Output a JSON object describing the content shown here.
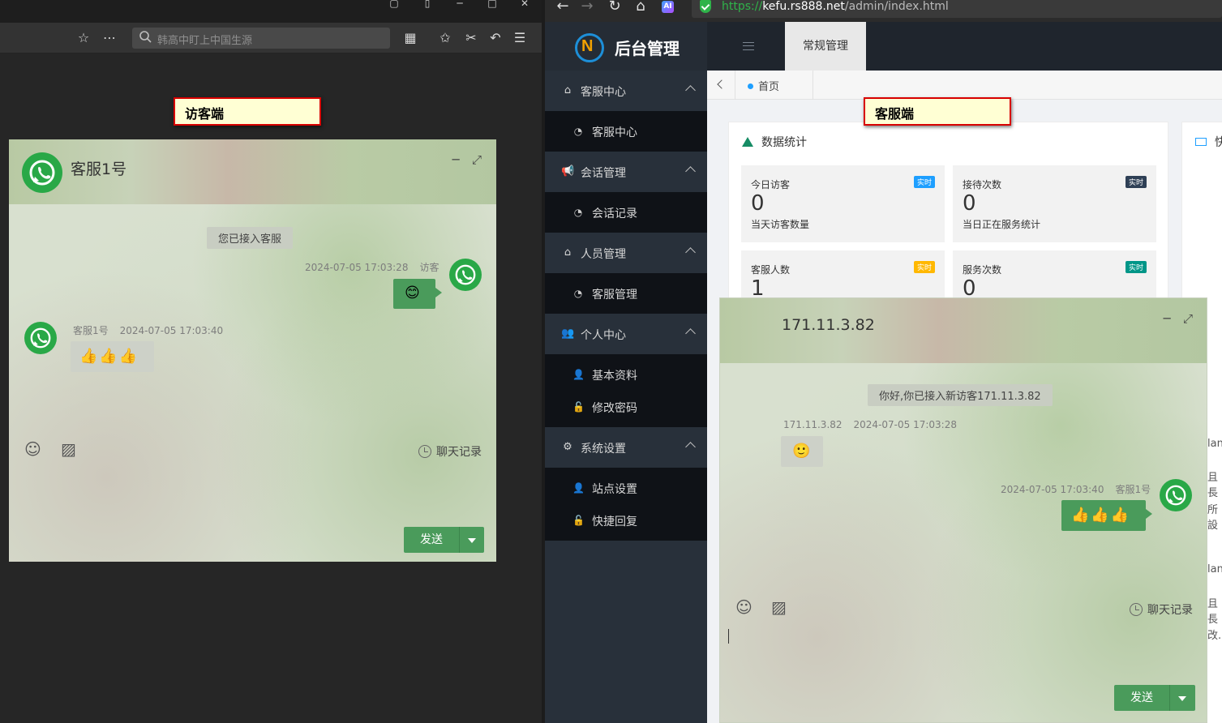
{
  "left_window": {
    "search_placeholder": "韩高中盯上中国生源",
    "annotation": "访客端",
    "chat": {
      "title": "客服1号",
      "system_message": "您已接入客服",
      "messages": [
        {
          "side": "right",
          "sender": "访客",
          "time": "2024-07-05 17:03:28",
          "content": "😊"
        },
        {
          "side": "left",
          "sender": "客服1号",
          "time": "2024-07-05 17:03:40",
          "content": "👍👍👍"
        }
      ],
      "history_label": "聊天记录",
      "send_label": "发送"
    }
  },
  "right_window": {
    "url": {
      "scheme": "https://",
      "host": "kefu.rs888.net",
      "path": "/admin/index.html"
    },
    "ai_label": "AI",
    "logo_text": "后台管理",
    "top_tab": "常规管理",
    "home_tab": "首页",
    "annotation": "客服端",
    "sidebar": [
      {
        "label": "客服中心",
        "icon": "home-icon",
        "items": [
          {
            "label": "客服中心",
            "icon": "dashboard-icon"
          }
        ]
      },
      {
        "label": "会话管理",
        "icon": "megaphone-icon",
        "items": [
          {
            "label": "会话记录",
            "icon": "dashboard-icon"
          }
        ]
      },
      {
        "label": "人员管理",
        "icon": "home-icon",
        "items": [
          {
            "label": "客服管理",
            "icon": "dashboard-icon"
          }
        ]
      },
      {
        "label": "个人中心",
        "icon": "users-icon",
        "items": [
          {
            "label": "基本资料",
            "icon": "user-icon"
          },
          {
            "label": "修改密码",
            "icon": "lock-icon"
          }
        ]
      },
      {
        "label": "系统设置",
        "icon": "gears-icon",
        "items": [
          {
            "label": "站点设置",
            "icon": "user-icon"
          },
          {
            "label": "快捷回复",
            "icon": "lock-icon"
          }
        ]
      }
    ],
    "stats": {
      "title": "数据统计",
      "cards": [
        {
          "label": "今日访客",
          "value": "0",
          "sub": "当天访客数量",
          "badge": "实时",
          "badge_color": "#1e9fff"
        },
        {
          "label": "接待次数",
          "value": "0",
          "sub": "当日正在服务统计",
          "badge": "实时",
          "badge_color": "#2f4056"
        },
        {
          "label": "客服人数",
          "value": "1",
          "sub": "",
          "badge": "实时",
          "badge_color": "#ffb800"
        },
        {
          "label": "服务次数",
          "value": "0",
          "sub": "",
          "badge": "实时",
          "badge_color": "#009688"
        }
      ]
    },
    "second_panel_title": "快",
    "edge_texts": [
      "lan",
      "且長",
      "所設",
      "lan",
      "且長",
      "改."
    ],
    "chat": {
      "title": "171.11.3.82",
      "system_message": "你好,你已接入新访客171.11.3.82",
      "messages": [
        {
          "side": "left",
          "sender": "171.11.3.82",
          "time": "2024-07-05 17:03:28",
          "content": "🙂"
        },
        {
          "side": "right",
          "sender": "客服1号",
          "time": "2024-07-05 17:03:40",
          "content": "👍👍👍"
        }
      ],
      "history_label": "聊天记录",
      "send_label": "发送"
    }
  },
  "colors": {
    "accent_green": "#4a9b5b",
    "whatsapp_green": "#29a847",
    "sidebar_bg": "#28303a",
    "annotation_border": "#d80000"
  }
}
